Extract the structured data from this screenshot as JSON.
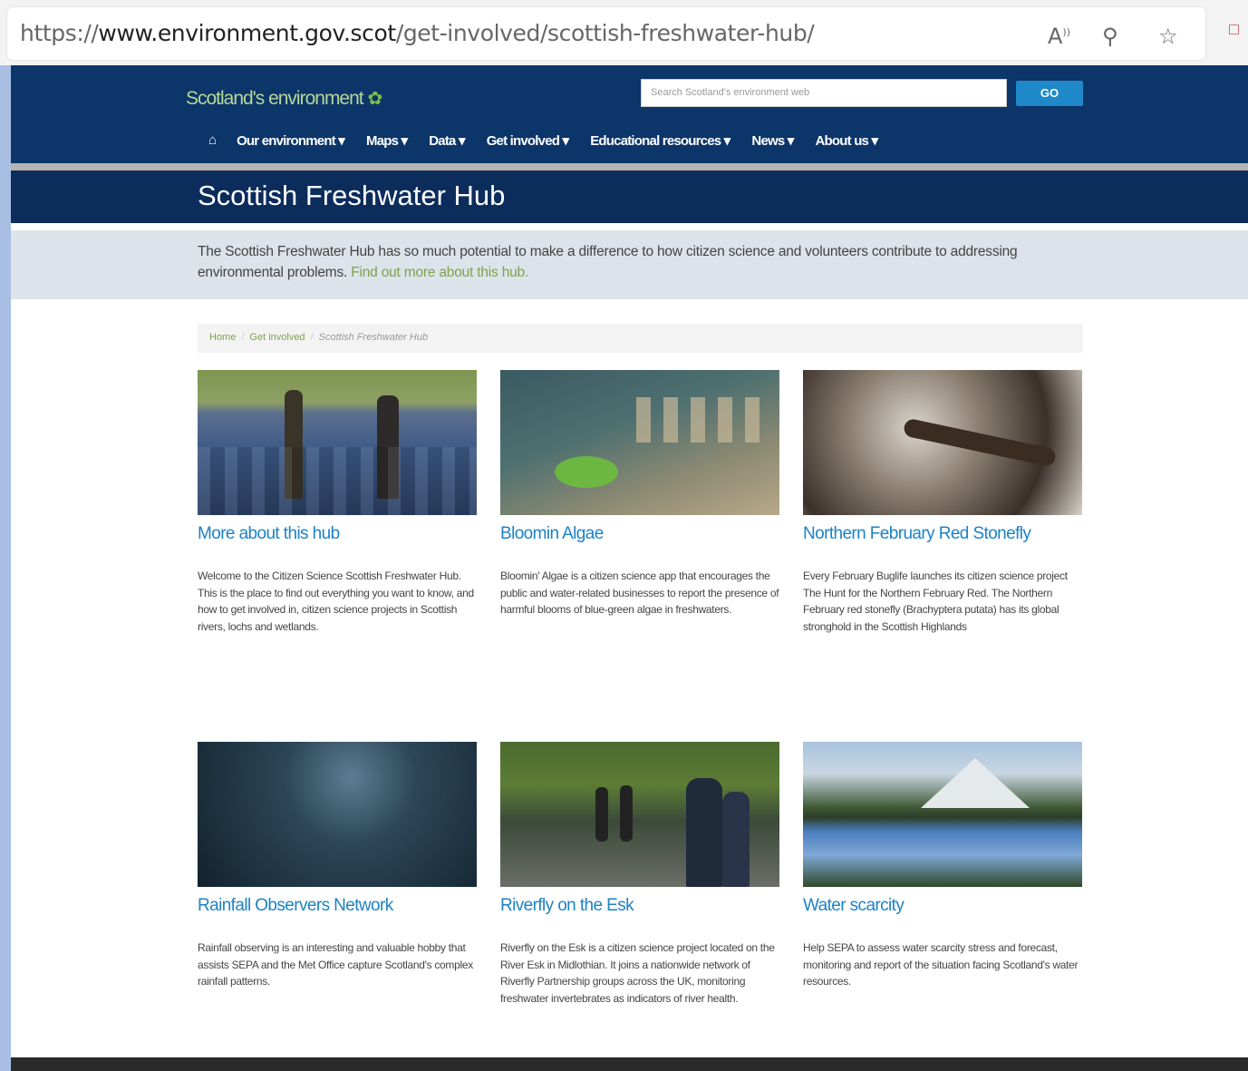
{
  "browser": {
    "url_scheme": "https://",
    "url_host": "www.environment.gov.scot",
    "url_path": "/get-involved/scottish-freshwater-hub/",
    "icons": [
      "read-aloud-icon",
      "zoom-out-icon",
      "favorites-add-icon"
    ]
  },
  "site": {
    "logo_text": "Scotland's environment",
    "search_placeholder": "Search Scotland's environment web",
    "go_label": "GO",
    "nav": [
      "Our environment ▾",
      "Maps ▾",
      "Data ▾",
      "Get involved ▾",
      "Educational resources ▾",
      "News ▾",
      "About us ▾"
    ]
  },
  "page": {
    "title": "Scottish Freshwater Hub",
    "intro": "The Scottish Freshwater Hub has so much potential to make a difference to how citizen science and volunteers contribute to addressing environmental problems.",
    "intro_link": "Find out more about this hub."
  },
  "breadcrumb": {
    "home": "Home",
    "get_involved": "Get involved",
    "current": "Scottish Freshwater Hub"
  },
  "cards": [
    {
      "title": "More about this hub",
      "desc": "Welcome to the Citizen Science Scottish Freshwater Hub. This is the place to find out everything you want to know, and how to get involved in, citizen science projects in Scottish rivers, lochs and wetlands."
    },
    {
      "title": "Bloomin Algae",
      "desc": "Bloomin' Algae is a citizen science app that encourages the public and water-related businesses to report the presence of harmful blooms of blue-green algae in freshwaters."
    },
    {
      "title": "Northern February Red Stonefly",
      "desc": "Every February Buglife launches its citizen science project The Hunt for the Northern February Red. The Northern February red stonefly (Brachyptera putata) has its global stronghold in the Scottish Highlands"
    },
    {
      "title": "Rainfall Observers Network",
      "desc": "Rainfall observing is an interesting and valuable hobby that assists SEPA and the Met Office capture Scotland's complex rainfall patterns."
    },
    {
      "title": "Riverfly on the Esk",
      "desc": "Riverfly on the Esk is a citizen science project located on the River Esk in Midlothian. It joins a nationwide network of Riverfly Partnership groups across the UK, monitoring freshwater invertebrates as indicators of river health."
    },
    {
      "title": "Water scarcity",
      "desc": "Help SEPA to assess water scarcity stress and forecast, monitoring and report of the situation facing Scotland's water resources."
    }
  ],
  "colors": {
    "header_bg": "#0c3569",
    "title_bg": "#0c2c5c",
    "link_blue": "#1d82c4",
    "link_green": "#7ea34b",
    "go_button": "#1e88c9"
  }
}
